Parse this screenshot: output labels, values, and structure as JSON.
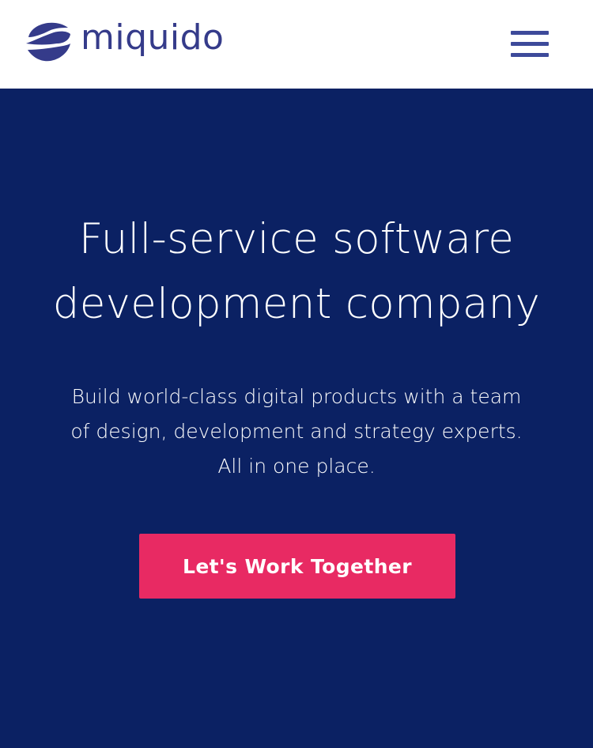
{
  "header": {
    "logo_text": "miquido",
    "logo_icon": "miquido-logo-mark",
    "menu_icon": "hamburger-menu-icon"
  },
  "hero": {
    "title_line1": "Full-service software",
    "title_line2": "development company",
    "subtitle_line1": "Build world-class digital products with a team",
    "subtitle_line2": "of design, development and strategy experts.",
    "subtitle_line3": "All in one place.",
    "cta_label": "Let's Work Together"
  },
  "colors": {
    "brand_purple": "#353b8a",
    "menu_bar": "#3d4a9a",
    "hero_background": "#0b2163",
    "cta_background": "#e82a63",
    "text_on_dark": "#ffffff",
    "header_background": "#ffffff"
  }
}
